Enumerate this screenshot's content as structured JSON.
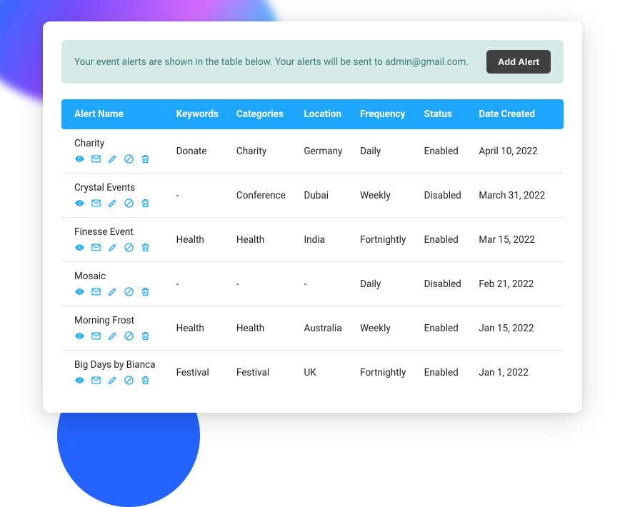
{
  "banner": {
    "text": "Your event alerts are shown in the table below. Your alerts will be sent to admin@gmail.com.",
    "button": "Add Alert"
  },
  "table": {
    "headers": {
      "name": "Alert Name",
      "keywords": "Keywords",
      "categories": "Categories",
      "location": "Location",
      "frequency": "Frequency",
      "status": "Status",
      "date": "Date Created"
    },
    "rows": [
      {
        "name": "Charity",
        "keywords": "Donate",
        "categories": "Charity",
        "location": "Germany",
        "frequency": "Daily",
        "status": "Enabled",
        "date": "April 10, 2022"
      },
      {
        "name": "Crystal Events",
        "keywords": "-",
        "categories": "Conference",
        "location": "Dubai",
        "frequency": "Weekly",
        "status": "Disabled",
        "date": "March 31, 2022"
      },
      {
        "name": "Finesse Event",
        "keywords": "Health",
        "categories": "Health",
        "location": "India",
        "frequency": "Fortnightly",
        "status": "Enabled",
        "date": "Mar 15, 2022"
      },
      {
        "name": "Mosaic",
        "keywords": "-",
        "categories": "-",
        "location": "-",
        "frequency": "Daily",
        "status": "Disabled",
        "date": "Feb 21, 2022"
      },
      {
        "name": "Morning Frost",
        "keywords": "Health",
        "categories": "Health",
        "location": "Australia",
        "frequency": "Weekly",
        "status": "Enabled",
        "date": "Jan 15, 2022"
      },
      {
        "name": "Big Days by Bianca",
        "keywords": "Festival",
        "categories": "Festival",
        "location": "UK",
        "frequency": "Fortnightly",
        "status": "Enabled",
        "date": "Jan 1, 2022"
      }
    ]
  }
}
